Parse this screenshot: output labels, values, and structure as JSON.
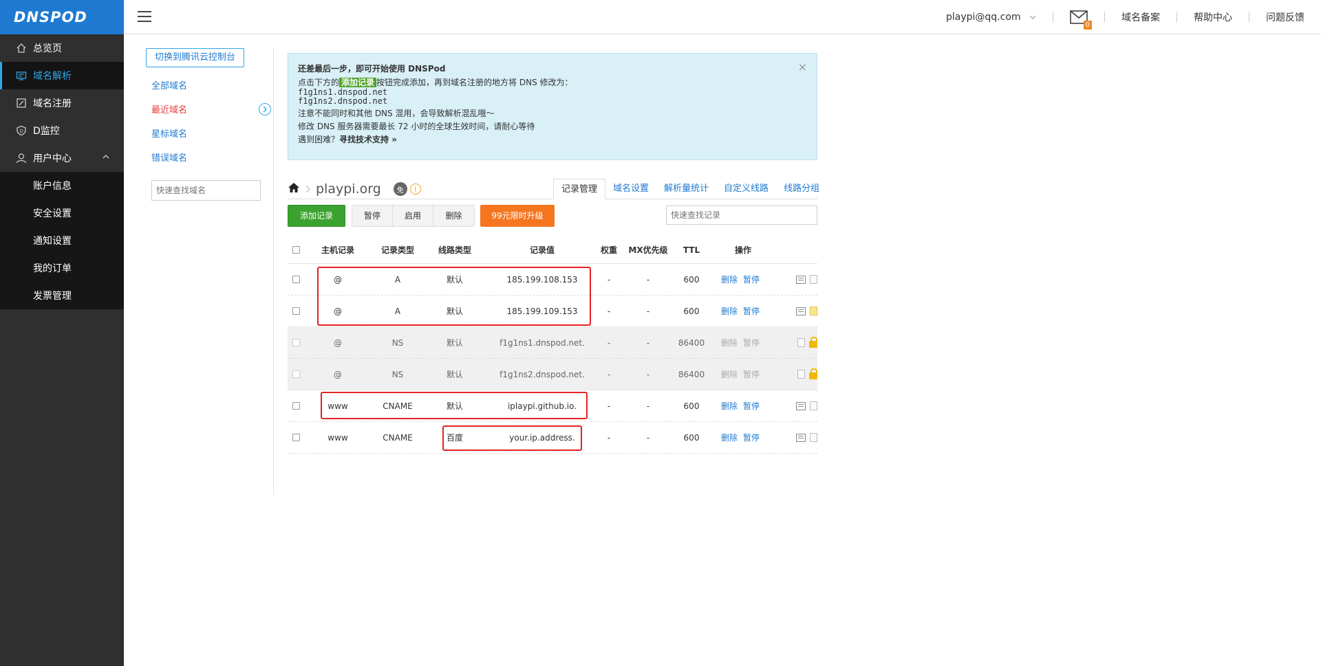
{
  "sidebar": {
    "logo": "DNSPOD",
    "items": [
      {
        "label": "总览页"
      },
      {
        "label": "域名解析"
      },
      {
        "label": "域名注册"
      },
      {
        "label": "D监控"
      },
      {
        "label": "用户中心"
      }
    ],
    "user_center_sub": [
      {
        "label": "账户信息"
      },
      {
        "label": "安全设置"
      },
      {
        "label": "通知设置"
      },
      {
        "label": "我的订单"
      },
      {
        "label": "发票管理"
      }
    ]
  },
  "topbar": {
    "email": "playpi@qq.com",
    "mail_count": "0",
    "links": [
      "域名备案",
      "帮助中心",
      "问题反馈"
    ]
  },
  "domain_nav": {
    "switch_label": "切换到腾讯云控制台",
    "links": [
      "全部域名",
      "最近域名",
      "星标域名",
      "错误域名"
    ],
    "search_placeholder": "快速查找域名"
  },
  "notice": {
    "title": "还差最后一步，即可开始使用 DNSPod",
    "line1_before": "点击下方的",
    "line1_tag": "添加记录",
    "line1_after": "按钮完成添加，再到域名注册的地方将 DNS 修改为：",
    "ns1": "f1g1ns1.dnspod.net",
    "ns2": "f1g1ns2.dnspod.net",
    "line2": "注意不能同时和其他 DNS 混用，会导致解析混乱哦～",
    "line3": "修改 DNS 服务器需要最长 72 小时的全球生效时间，请耐心等待",
    "line4_before": "遇到困难？",
    "line4_link": "寻找技术支持 »",
    "close": "×"
  },
  "domain": {
    "name": "playpi.org",
    "badge": "免",
    "info": "i"
  },
  "tabs": [
    "记录管理",
    "域名设置",
    "解析量统计",
    "自定义线路",
    "线路分组"
  ],
  "toolbar": {
    "add": "添加记录",
    "pause": "暂停",
    "enable": "启用",
    "delete": "删除",
    "upgrade": "99元限时升级",
    "search_placeholder": "快速查找记录"
  },
  "table": {
    "headers": {
      "host": "主机记录",
      "type": "记录类型",
      "line": "线路类型",
      "value": "记录值",
      "weight": "权重",
      "mx": "MX优先级",
      "ttl": "TTL",
      "ops": "操作"
    },
    "op_delete": "删除",
    "op_pause": "暂停",
    "rows": [
      {
        "host": "@",
        "type": "A",
        "line": "默认",
        "value": "185.199.108.153",
        "weight": "-",
        "mx": "-",
        "ttl": "600"
      },
      {
        "host": "@",
        "type": "A",
        "line": "默认",
        "value": "185.199.109.153",
        "weight": "-",
        "mx": "-",
        "ttl": "600"
      },
      {
        "host": "@",
        "type": "NS",
        "line": "默认",
        "value": "f1g1ns1.dnspod.net.",
        "weight": "-",
        "mx": "-",
        "ttl": "86400"
      },
      {
        "host": "@",
        "type": "NS",
        "line": "默认",
        "value": "f1g1ns2.dnspod.net.",
        "weight": "-",
        "mx": "-",
        "ttl": "86400"
      },
      {
        "host": "www",
        "type": "CNAME",
        "line": "默认",
        "value": "iplaypi.github.io.",
        "weight": "-",
        "mx": "-",
        "ttl": "600"
      },
      {
        "host": "www",
        "type": "CNAME",
        "line": "百度",
        "value": "your.ip.address.",
        "weight": "-",
        "mx": "-",
        "ttl": "600"
      }
    ]
  },
  "colors": {
    "brand": "#1e7ad1",
    "sidebar_bg": "#2f2f2f",
    "highlight": "#e42121",
    "add_button": "#3ba22f",
    "upgrade_button": "#f5761f"
  }
}
